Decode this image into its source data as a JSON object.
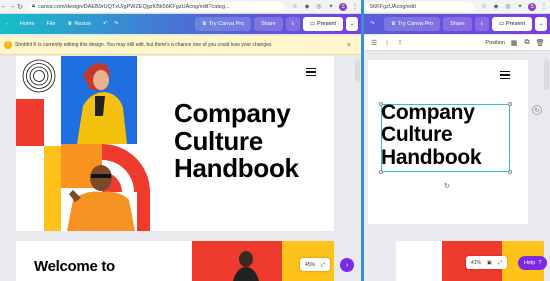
{
  "left": {
    "url": "canva.com/design/DAEB9rUQTxU/gPWZEQgzKBk56KFgzUAcog/edit?categ...",
    "menu": {
      "home": "Home",
      "file": "File",
      "resize": "Resize"
    },
    "buttons": {
      "try_pro": "Try Canva Pro",
      "share": "Share",
      "present": "Present"
    },
    "notice": "Shobhit K is currently editing this design. You may still edit, but there's a chance one of you could lose your changes.",
    "title_lines": [
      "Company",
      "Culture",
      "Handbook"
    ],
    "page2_heading": "Welcome to",
    "zoom": "45%",
    "avatar_letter": "S"
  },
  "right": {
    "url": "56KFgzUAcog/edit",
    "buttons": {
      "try_pro": "Try Canva Pro",
      "share": "Share",
      "present": "Present"
    },
    "toolbar_position": "Position",
    "title_lines": [
      "Company",
      "Culture",
      "Handbook"
    ],
    "zoom": "41%",
    "help": "Help",
    "help_mark": "?"
  },
  "colors": {
    "red": "#ef3b2d",
    "blue": "#1f6fe0",
    "yellow": "#ffc21a",
    "orange": "#f7931e",
    "page_bg": "#ffffff",
    "canva_purple": "#7d2ae8",
    "selection": "#29c5d0"
  }
}
